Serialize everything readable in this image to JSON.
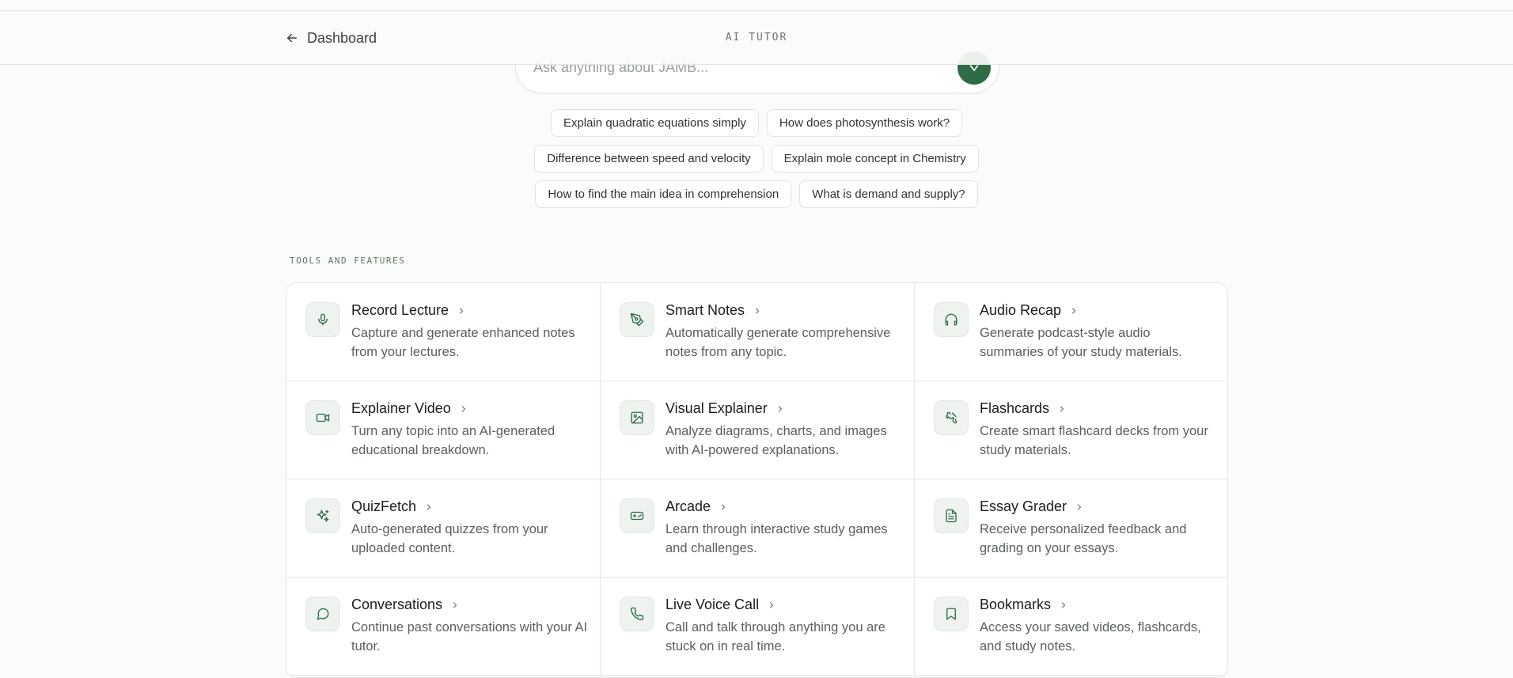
{
  "header": {
    "back_label": "Dashboard",
    "title": "AI TUTOR"
  },
  "search": {
    "placeholder": "Ask anything about JAMB...",
    "send_icon": "send-icon",
    "accent": "#2f6b47"
  },
  "suggestions": {
    "rows": [
      [
        "Explain quadratic equations simply",
        "How does photosynthesis work?"
      ],
      [
        "Difference between speed and velocity",
        "Explain mole concept in Chemistry"
      ],
      [
        "How to find the main idea in comprehension",
        "What is demand and supply?"
      ]
    ]
  },
  "tools": {
    "section_label": "TOOLS AND FEATURES",
    "items": [
      {
        "title": "Record Lecture",
        "desc": "Capture and generate enhanced notes from your lectures.",
        "icon": "microphone-icon"
      },
      {
        "title": "Smart Notes",
        "desc": "Automatically generate comprehensive notes from any topic.",
        "icon": "pen-tool-icon"
      },
      {
        "title": "Audio Recap",
        "desc": "Generate podcast-style audio summaries of your study materials.",
        "icon": "headphones-icon"
      },
      {
        "title": "Explainer Video",
        "desc": "Turn any topic into an AI-generated educational breakdown.",
        "icon": "video-camera-icon"
      },
      {
        "title": "Visual Explainer",
        "desc": "Analyze diagrams, charts, and images with AI-powered explanations.",
        "icon": "image-icon"
      },
      {
        "title": "Flashcards",
        "desc": "Create smart flashcard decks from your study materials.",
        "icon": "puzzle-icon"
      },
      {
        "title": "QuizFetch",
        "desc": "Auto-generated quizzes from your uploaded content.",
        "icon": "sparkles-icon"
      },
      {
        "title": "Arcade",
        "desc": "Learn through interactive study games and challenges.",
        "icon": "gamepad-icon"
      },
      {
        "title": "Essay Grader",
        "desc": "Receive personalized feedback and grading on your essays.",
        "icon": "document-icon"
      },
      {
        "title": "Conversations",
        "desc": "Continue past conversations with your AI tutor.",
        "icon": "chat-bubble-icon"
      },
      {
        "title": "Live Voice Call",
        "desc": "Call and talk through anything you are stuck on in real time.",
        "icon": "phone-icon"
      },
      {
        "title": "Bookmarks",
        "desc": "Access your saved videos, flashcards, and study notes.",
        "icon": "bookmark-icon"
      }
    ]
  }
}
